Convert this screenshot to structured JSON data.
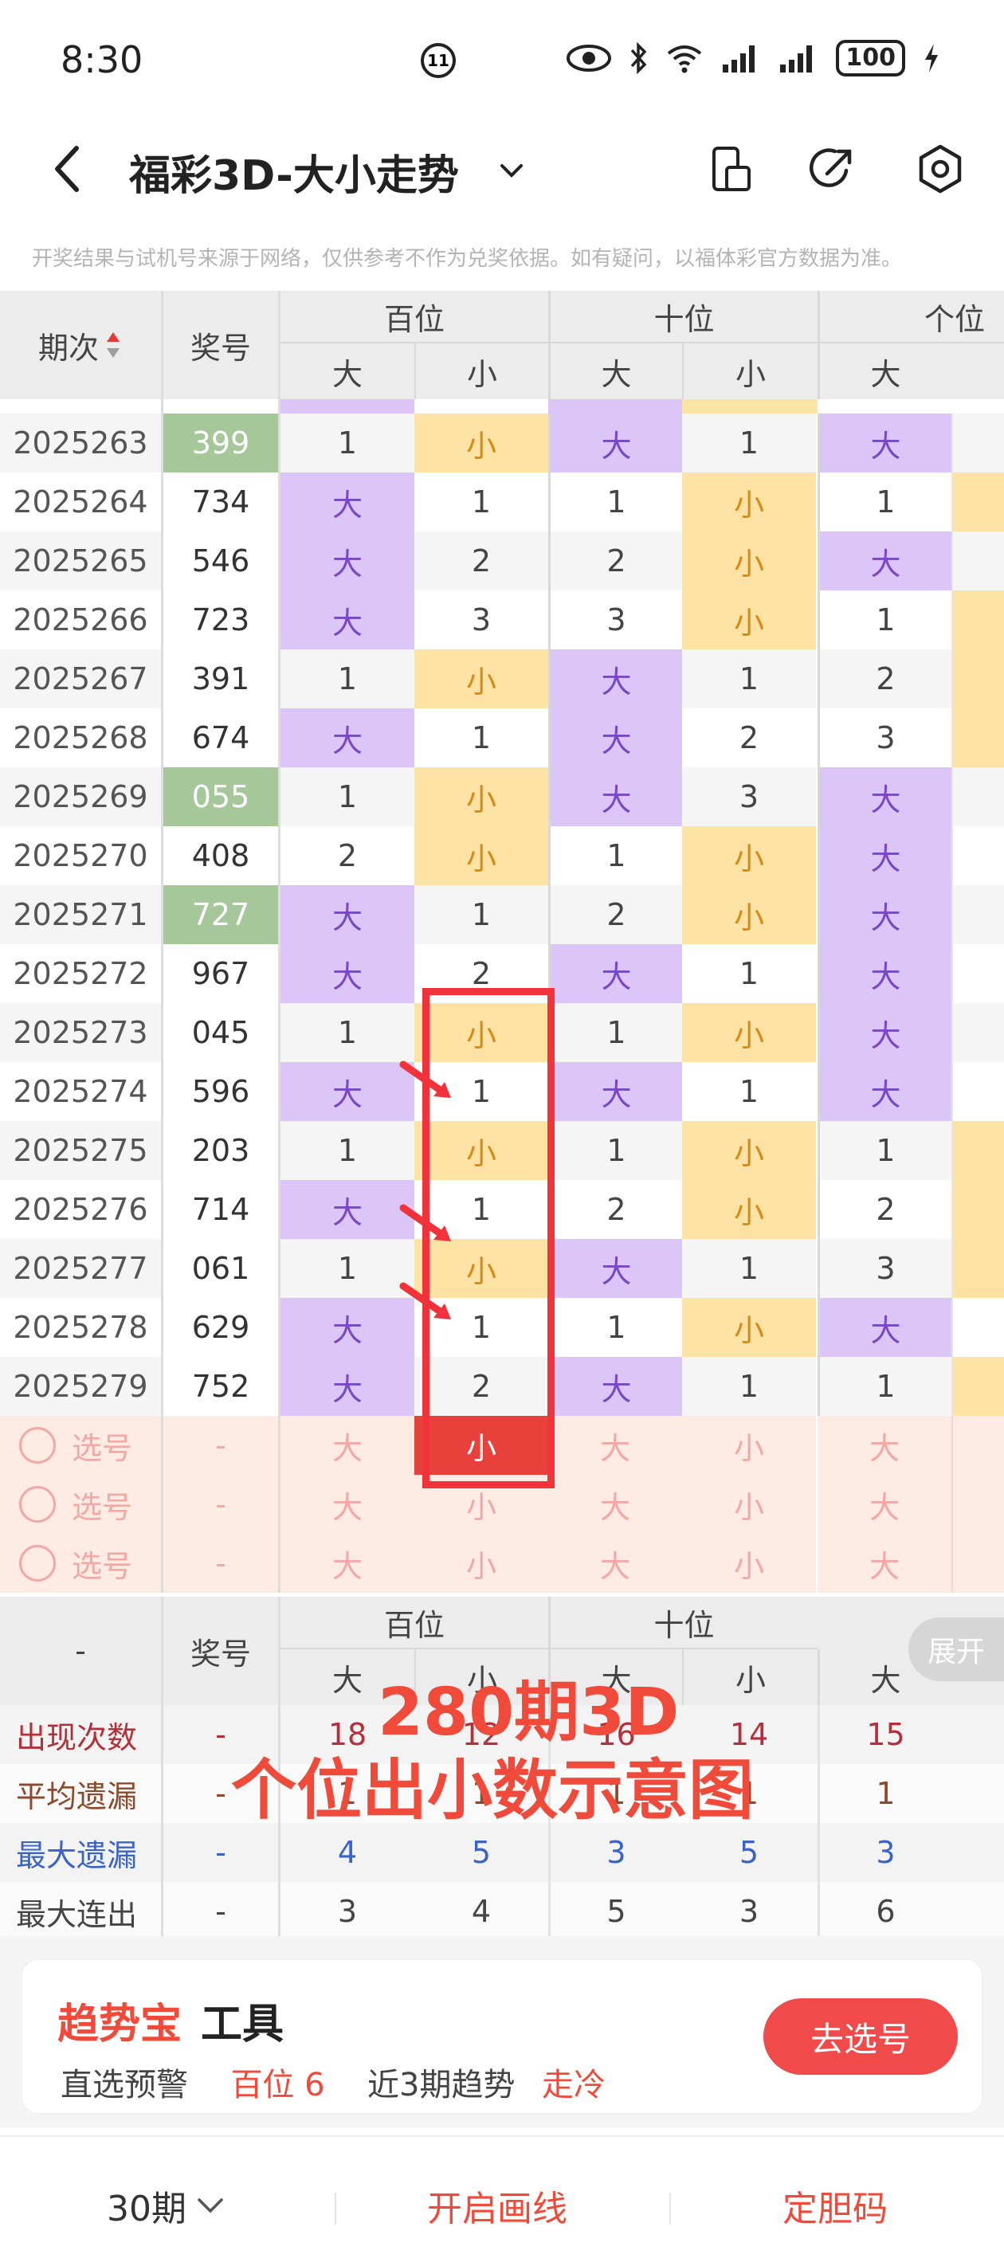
{
  "status_bar": {
    "time": "8:30",
    "battery": "100",
    "alarm": "11"
  },
  "header": {
    "title": "福彩3D-大小走势"
  },
  "notice": "开奖结果与试机号来源于网络，仅供参考不作为兑奖依据。如有疑问，以福体彩官方数据为准。",
  "table_header": {
    "period": "期次",
    "number": "奖号",
    "group_hundreds": "百位",
    "group_tens": "十位",
    "group_ones": "个位",
    "big": "大",
    "small": "小"
  },
  "rows": [
    {
      "period": "2025263",
      "number": "399",
      "green": true,
      "cells": [
        "1",
        "小",
        "大",
        "1",
        "大"
      ]
    },
    {
      "period": "2025264",
      "number": "734",
      "green": false,
      "cells": [
        "大",
        "1",
        "1",
        "小",
        "1"
      ]
    },
    {
      "period": "2025265",
      "number": "546",
      "green": false,
      "cells": [
        "大",
        "2",
        "2",
        "小",
        "大"
      ]
    },
    {
      "period": "2025266",
      "number": "723",
      "green": false,
      "cells": [
        "大",
        "3",
        "3",
        "小",
        "1"
      ]
    },
    {
      "period": "2025267",
      "number": "391",
      "green": false,
      "cells": [
        "1",
        "小",
        "大",
        "1",
        "2"
      ]
    },
    {
      "period": "2025268",
      "number": "674",
      "green": false,
      "cells": [
        "大",
        "1",
        "大",
        "2",
        "3"
      ]
    },
    {
      "period": "2025269",
      "number": "055",
      "green": true,
      "cells": [
        "1",
        "小",
        "大",
        "3",
        "大"
      ]
    },
    {
      "period": "2025270",
      "number": "408",
      "green": false,
      "cells": [
        "2",
        "小",
        "1",
        "小",
        "大"
      ]
    },
    {
      "period": "2025271",
      "number": "727",
      "green": true,
      "cells": [
        "大",
        "1",
        "2",
        "小",
        "大"
      ]
    },
    {
      "period": "2025272",
      "number": "967",
      "green": false,
      "cells": [
        "大",
        "2",
        "大",
        "1",
        "大"
      ]
    },
    {
      "period": "2025273",
      "number": "045",
      "green": false,
      "cells": [
        "1",
        "小",
        "1",
        "小",
        "大"
      ]
    },
    {
      "period": "2025274",
      "number": "596",
      "green": false,
      "cells": [
        "大",
        "1",
        "大",
        "1",
        "大"
      ]
    },
    {
      "period": "2025275",
      "number": "203",
      "green": false,
      "cells": [
        "1",
        "小",
        "1",
        "小",
        "1"
      ]
    },
    {
      "period": "2025276",
      "number": "714",
      "green": false,
      "cells": [
        "大",
        "1",
        "2",
        "小",
        "2"
      ]
    },
    {
      "period": "2025277",
      "number": "061",
      "green": false,
      "cells": [
        "1",
        "小",
        "大",
        "1",
        "3"
      ]
    },
    {
      "period": "2025278",
      "number": "629",
      "green": false,
      "cells": [
        "大",
        "1",
        "1",
        "小",
        "大"
      ]
    },
    {
      "period": "2025279",
      "number": "752",
      "green": false,
      "cells": [
        "大",
        "2",
        "大",
        "1",
        "1"
      ]
    }
  ],
  "select_rows": {
    "label": "选号",
    "dash": "-",
    "cells": [
      "大",
      "小",
      "大",
      "小",
      "大"
    ]
  },
  "stats": {
    "dash": "-",
    "number_header": "奖号",
    "expand_label": "展开",
    "rows": [
      {
        "label": "出现次数",
        "dash": "-",
        "values": [
          "18",
          "12",
          "16",
          "14",
          "15"
        ],
        "color": "#b3303a"
      },
      {
        "label": "平均遗漏",
        "dash": "-",
        "values": [
          "1",
          "1",
          "1",
          "1",
          "1"
        ],
        "color": "#8b4a2b"
      },
      {
        "label": "最大遗漏",
        "dash": "-",
        "values": [
          "4",
          "5",
          "3",
          "5",
          "3"
        ],
        "color": "#3a63c8"
      },
      {
        "label": "最大连出",
        "dash": "-",
        "values": [
          "3",
          "4",
          "5",
          "3",
          "6"
        ],
        "color": "#444444"
      }
    ]
  },
  "overlay": {
    "line1": "280期3D",
    "line2": "个位出小数示意图"
  },
  "tool": {
    "title_red": "趋势宝",
    "title_black": "工具",
    "line_prefix": "直选预警",
    "line_red1": "百位 6",
    "line_mid": "近3期趋势",
    "line_red2": "走冷",
    "button": "去选号"
  },
  "bottom": {
    "periods": "30期",
    "draw_line": "开启画线",
    "dan_code": "定胆码"
  },
  "colors": {
    "accent": "#f04a3b",
    "big_bg": "#dcc5f7",
    "small_bg": "#fde2a6",
    "green_num": "#a5c799"
  }
}
